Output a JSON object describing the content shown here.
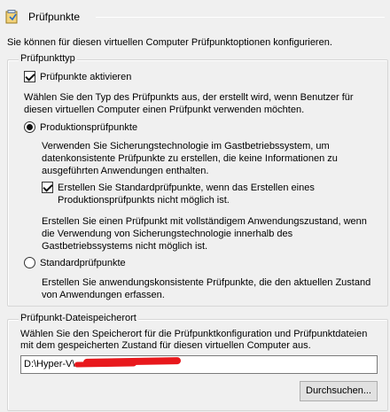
{
  "header": {
    "title": "Prüfpunkte",
    "icon": "checkpoint-icon"
  },
  "intro": "Sie können für diesen virtuellen Computer Prüfpunktoptionen konfigurieren.",
  "checkpoint_type": {
    "legend": "Prüfpunkttyp",
    "enable_label": "Prüfpunkte aktivieren",
    "enable_checked": true,
    "description_line1": "Wählen Sie den Typ des Prüfpunkts aus, der erstellt wird, wenn Benutzer für",
    "description_line2": "diesen virtuellen Computer einen Prüfpunkt verwenden möchten.",
    "production": {
      "label": "Produktionsprüfpunkte",
      "selected": true,
      "desc_line1": "Verwenden Sie Sicherungstechnologie im Gastbetriebssystem, um",
      "desc_line2": "datenkonsistente Prüfpunkte zu erstellen, die keine Informationen zu",
      "desc_line3": "ausgeführten Anwendungen enthalten.",
      "fallback_line1": "Erstellen Sie Standardprüfpunkte, wenn das Erstellen eines",
      "fallback_line2": "Produktionsprüfpunkts nicht möglich ist.",
      "fallback_checked": true,
      "fallback_info_line1": "Erstellen Sie einen Prüfpunkt mit vollständigem Anwendungszustand, wenn",
      "fallback_info_line2": "die Verwendung von Sicherungstechnologie innerhalb des",
      "fallback_info_line3": "Gastbetriebssystems nicht möglich ist."
    },
    "standard": {
      "label": "Standardprüfpunkte",
      "selected": false,
      "desc_line1": "Erstellen Sie anwendungskonsistente Prüfpunkte, die den aktuellen Zustand",
      "desc_line2": "von Anwendungen erfassen."
    }
  },
  "file_location": {
    "legend": "Prüfpunkt-Dateispeicherort",
    "desc_line1": "Wählen Sie den Speicherort für die Prüfpunktkonfiguration und Prüfpunktdateien",
    "desc_line2": "mit dem gespeicherten Zustand für diesen virtuellen Computer aus.",
    "path": "D:\\Hyper-V\\",
    "browse_label": "Durchsuchen..."
  },
  "colors": {
    "background": "#f0f0f0",
    "redaction": "#e8181c"
  }
}
